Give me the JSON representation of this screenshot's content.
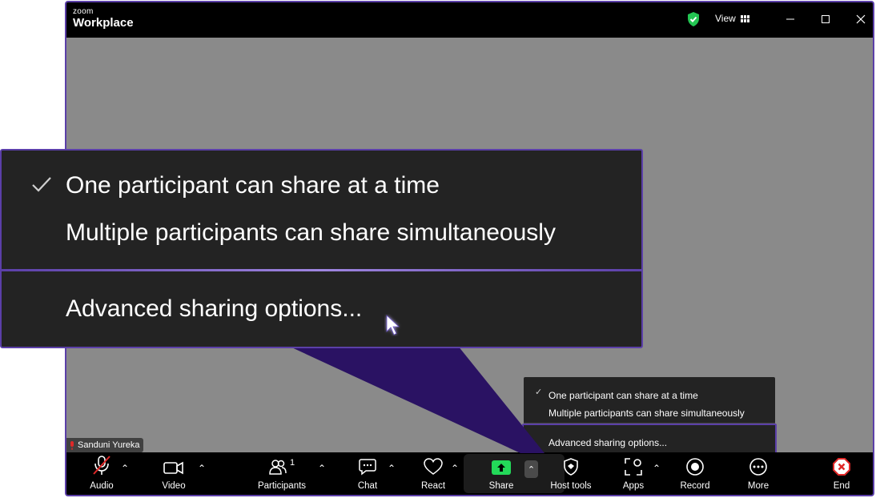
{
  "titlebar": {
    "brand_small": "zoom",
    "brand_big": "Workplace",
    "view_label": "View"
  },
  "participant": {
    "name": "Sanduni Yureka"
  },
  "toolbar": {
    "audio": "Audio",
    "video": "Video",
    "participants": "Participants",
    "participants_count": "1",
    "chat": "Chat",
    "react": "React",
    "share": "Share",
    "host_tools": "Host tools",
    "apps": "Apps",
    "record": "Record",
    "more": "More",
    "end": "End"
  },
  "share_menu": {
    "items": [
      {
        "label": "One participant can share at a time",
        "checked": true
      },
      {
        "label": "Multiple participants can share simultaneously",
        "checked": false
      },
      {
        "label": "Advanced sharing options...",
        "checked": false
      }
    ]
  },
  "colors": {
    "accent": "#5b3fa8",
    "share_green": "#23d959",
    "end_red": "#e02828",
    "shield_green": "#23c552"
  }
}
